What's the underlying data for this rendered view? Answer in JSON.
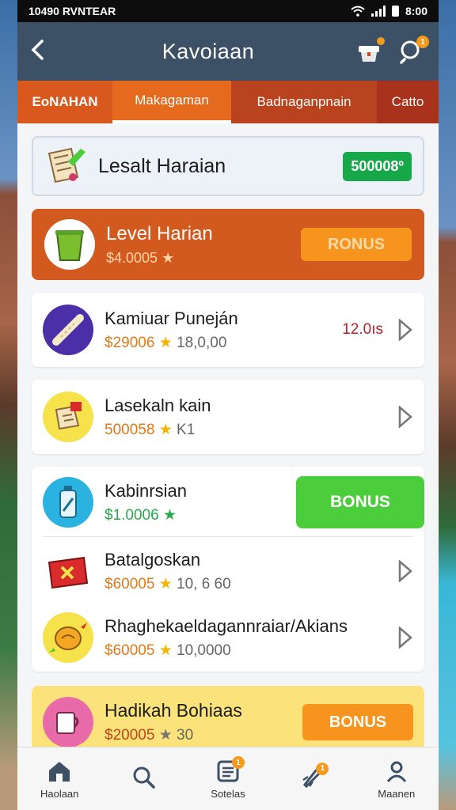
{
  "status": {
    "left": "10490 RVNTEAR",
    "time": "8:00"
  },
  "header": {
    "title": "Kavoiaan"
  },
  "tabs": [
    "EoNAHAN",
    "Makagaman",
    "Badnaganpnain",
    "Catto"
  ],
  "banner": {
    "title": "Lesalt Haraian",
    "badge": "500008º"
  },
  "level": {
    "title": "Level Harian",
    "points": "$4.0005 ★",
    "button": "RONUS"
  },
  "items": [
    {
      "name": "Kamiuar Puneján",
      "price": "$29006",
      "star": "★",
      "count": "18,0,00",
      "value": "12.0ıs"
    },
    {
      "name": "Lasekaln kain",
      "price": "500058",
      "star": "★",
      "count": "K1"
    }
  ],
  "group": {
    "first": {
      "name": "Kabinrsian",
      "price": "$1.0006",
      "star": "★",
      "button": "BONUS"
    },
    "rows": [
      {
        "name": "Batalgoskan",
        "price": "$60005",
        "star": "★",
        "count": "10, 6 60"
      },
      {
        "name": "Rhaghekaeldagannraiar/Akians",
        "price": "$60005",
        "star": "★",
        "count": "10,0000"
      }
    ]
  },
  "bottom_item": {
    "name": "Hadikah Bohiaas",
    "price": "$20005",
    "star": "★",
    "count": "30",
    "button": "BONUS"
  },
  "nav": [
    {
      "label": "Haolaan",
      "icon": "home-icon"
    },
    {
      "label": "",
      "icon": "search-icon"
    },
    {
      "label": "Sotelas",
      "icon": "list-icon"
    },
    {
      "label": "",
      "icon": "rocket-icon"
    },
    {
      "label": "Maanen",
      "icon": "user-icon"
    }
  ],
  "colors": {
    "header": "#3d5166",
    "accent": "#e66a1e",
    "green": "#17a84a",
    "bonus_green": "#4ccd3c"
  }
}
